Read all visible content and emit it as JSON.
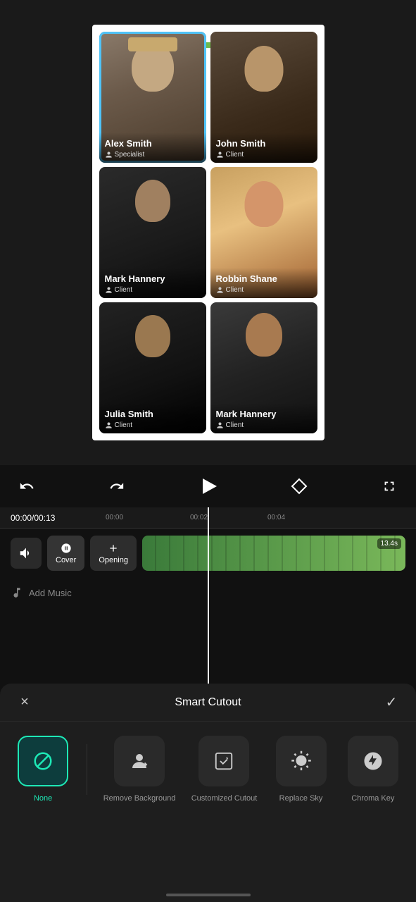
{
  "videoPreview": {
    "gridCards": [
      {
        "id": "alex-smith",
        "name": "Alex Smith",
        "role": "Specialist",
        "faceClass": "face-alex",
        "selected": true
      },
      {
        "id": "john-smith",
        "name": "John Smith",
        "role": "Client",
        "faceClass": "face-john",
        "selected": false
      },
      {
        "id": "mark-hannery",
        "name": "Mark Hannery",
        "role": "Client",
        "faceClass": "face-mark",
        "selected": false
      },
      {
        "id": "robbin-shane",
        "name": "Robbin Shane",
        "role": "Client",
        "faceClass": "face-robbin",
        "selected": false
      },
      {
        "id": "julia-smith",
        "name": "Julia Smith",
        "role": "Client",
        "faceClass": "face-julia",
        "selected": false
      },
      {
        "id": "mark-hannery-2",
        "name": "Mark Hannery",
        "role": "Client",
        "faceClass": "face-mark2",
        "selected": false
      }
    ]
  },
  "controls": {
    "undoLabel": "↩",
    "redoLabel": "↪",
    "playLabel": "▶",
    "keyframeLabel": "◇",
    "fullscreenLabel": "⛶"
  },
  "timeline": {
    "currentTime": "00:00",
    "totalTime": "00:13",
    "markers": [
      "00:00",
      "00:02",
      "00:04"
    ],
    "trackDuration": "13.4s",
    "coverLabel": "Cover",
    "openingLabel": "Opening",
    "addMusicLabel": "Add Music"
  },
  "smartCutout": {
    "title": "Smart Cutout",
    "closeLabel": "×",
    "confirmLabel": "✓",
    "options": [
      {
        "id": "none",
        "label": "None",
        "active": true
      },
      {
        "id": "remove-background",
        "label": "Remove Background",
        "active": false
      },
      {
        "id": "customized-cutout",
        "label": "Customized Cutout",
        "active": false
      },
      {
        "id": "replace-sky",
        "label": "Replace Sky",
        "active": false
      },
      {
        "id": "chroma-key",
        "label": "Chroma Key",
        "active": false
      }
    ]
  }
}
